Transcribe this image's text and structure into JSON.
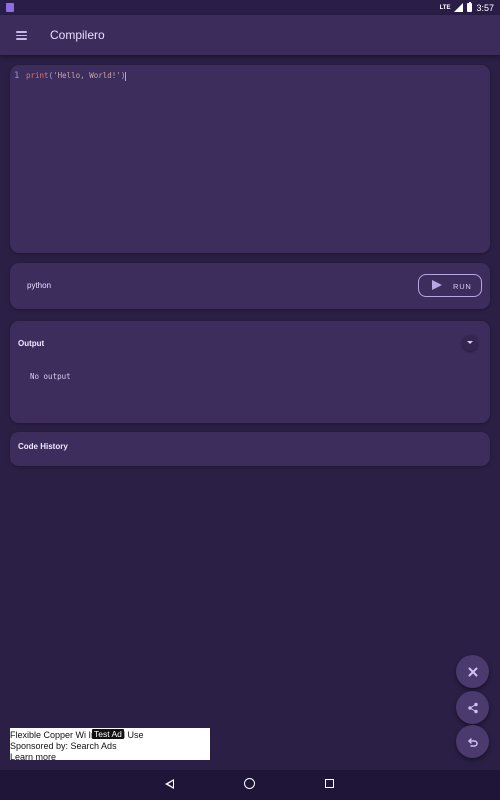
{
  "status_bar": {
    "network": "LTE",
    "time": "3:57"
  },
  "app_bar": {
    "title": "Compilero",
    "menu_icon": "hamburger-menu-icon"
  },
  "editor": {
    "line_number": "1",
    "code": {
      "function": "print",
      "open_paren": "(",
      "string": "'Hello, World!'",
      "close_paren": ")"
    }
  },
  "language_bar": {
    "language": "python",
    "run_label": "RUN",
    "run_icon": "play-icon"
  },
  "output": {
    "title": "Output",
    "text": "No output",
    "toggle_icon": "chevron-down-icon"
  },
  "history": {
    "title": "Code History"
  },
  "fabs": [
    {
      "icon": "close-icon"
    },
    {
      "icon": "share-icon"
    },
    {
      "icon": "undo-icon"
    }
  ],
  "ad": {
    "badge": "Test Ad",
    "line1": "Flexible Copper Wi Industrial Use",
    "line2": "Sponsored by: Search Ads",
    "line3": "Learn more"
  },
  "colors": {
    "background": "#2b1f45",
    "card": "#3c2d5d",
    "app_bar": "#3b2c5c",
    "accent": "#b7a6e0",
    "cursor": "#2ee0ff"
  }
}
